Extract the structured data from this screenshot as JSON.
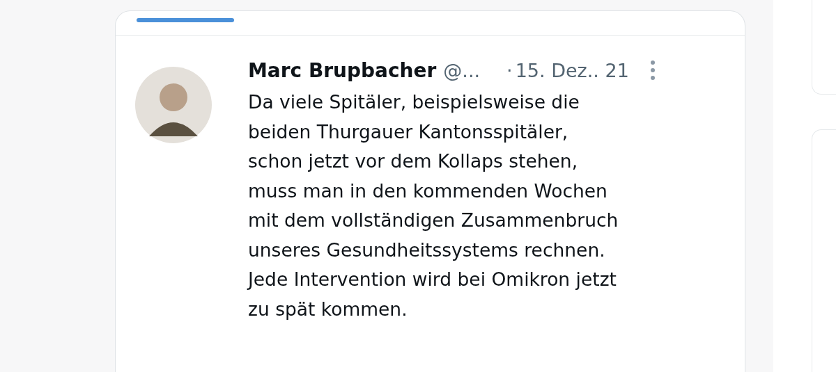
{
  "tweet": {
    "name": "Marc Brupbacher",
    "handle": "@...",
    "separator": "·",
    "date": "15. Dez.. 21",
    "text_lines": [
      "Da viele Spitäler, beispielsweise die",
      "beiden Thurgauer Kantonsspitäler,",
      "schon jetzt vor dem Kollaps stehen,",
      "muss man in den kommenden Wochen",
      "mit dem vollständigen Zusammenbruch",
      "unseres Gesundheitssystems rechnen.",
      "Jede Intervention wird bei Omikron jetzt",
      "zu spät kommen."
    ]
  }
}
